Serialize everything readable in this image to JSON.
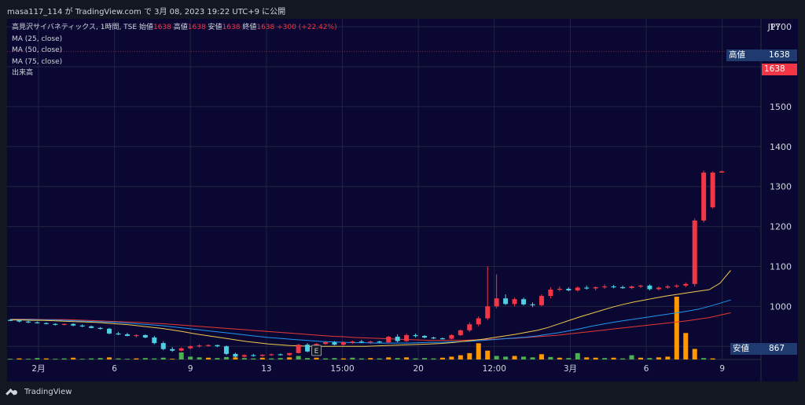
{
  "header": {
    "published_line": "masa117_114 が TradingView.com で 3月 08, 2023 19:22 UTC+9 に公開"
  },
  "legend": {
    "symbol_line": "高見沢サイバネティックス, 1時間, TSE",
    "open_label": "始値",
    "open_value": "1638",
    "high_label": "高値",
    "high_value": "1638",
    "low_label": "安値",
    "low_value": "1638",
    "close_label": "終値",
    "close_value": "1638",
    "change": "+300 (+22.42%)",
    "ma25": "MA (25, close)",
    "ma50": "MA (50, close)",
    "ma75": "MA (75, close)",
    "volume": "出来高"
  },
  "price_axis": {
    "currency": "JPY",
    "ticks": [
      "1700",
      "1600",
      "1500",
      "1400",
      "1300",
      "1200",
      "1100",
      "1000",
      "900"
    ],
    "high_tag_label": "高値",
    "high_tag_value": "1638",
    "last_price_tag": "1638",
    "low_tag_label": "安値",
    "low_tag_value": "867"
  },
  "time_axis": {
    "labels": [
      "2月",
      "6",
      "9",
      "13",
      "15:00",
      "20",
      "12:00",
      "3月",
      "6",
      "9"
    ]
  },
  "earnings_marker": "E",
  "footer": {
    "brand": "TradingView"
  },
  "colors": {
    "up": "#f23645",
    "down": "#22ab94",
    "down_light": "#4dd0e1",
    "ma25": "#f2c94c",
    "ma50": "#2196f3",
    "ma75": "#e53935",
    "vol_up": "#ff9800",
    "vol_down": "#4caf50",
    "tag_blue": "#1e3a6e",
    "last_red": "#f23645",
    "panel_bg": "#0a0833"
  },
  "chart_data": {
    "type": "candlestick",
    "ylim": [
      867,
      1720
    ],
    "y_ticks": [
      900,
      1000,
      1100,
      1200,
      1300,
      1400,
      1500,
      1600,
      1700
    ],
    "x": [
      "2月",
      "6",
      "9",
      "13",
      "15:00",
      "20",
      "12:00",
      "3月",
      "6",
      "9"
    ],
    "candles": [
      {
        "o": 966,
        "h": 968,
        "l": 963,
        "c": 965
      },
      {
        "o": 965,
        "h": 966,
        "l": 960,
        "c": 962
      },
      {
        "o": 962,
        "h": 964,
        "l": 958,
        "c": 960
      },
      {
        "o": 960,
        "h": 962,
        "l": 957,
        "c": 958
      },
      {
        "o": 958,
        "h": 960,
        "l": 955,
        "c": 956
      },
      {
        "o": 956,
        "h": 958,
        "l": 952,
        "c": 955
      },
      {
        "o": 955,
        "h": 957,
        "l": 952,
        "c": 956
      },
      {
        "o": 956,
        "h": 958,
        "l": 950,
        "c": 952
      },
      {
        "o": 952,
        "h": 955,
        "l": 948,
        "c": 950
      },
      {
        "o": 950,
        "h": 952,
        "l": 945,
        "c": 946
      },
      {
        "o": 946,
        "h": 948,
        "l": 942,
        "c": 944
      },
      {
        "o": 944,
        "h": 946,
        "l": 930,
        "c": 932
      },
      {
        "o": 932,
        "h": 936,
        "l": 928,
        "c": 930
      },
      {
        "o": 930,
        "h": 934,
        "l": 925,
        "c": 926
      },
      {
        "o": 926,
        "h": 930,
        "l": 922,
        "c": 928
      },
      {
        "o": 928,
        "h": 930,
        "l": 920,
        "c": 922
      },
      {
        "o": 922,
        "h": 926,
        "l": 905,
        "c": 908
      },
      {
        "o": 908,
        "h": 912,
        "l": 890,
        "c": 893
      },
      {
        "o": 893,
        "h": 898,
        "l": 886,
        "c": 889
      },
      {
        "o": 889,
        "h": 897,
        "l": 887,
        "c": 895
      },
      {
        "o": 895,
        "h": 902,
        "l": 893,
        "c": 900
      },
      {
        "o": 900,
        "h": 905,
        "l": 897,
        "c": 902
      },
      {
        "o": 902,
        "h": 905,
        "l": 899,
        "c": 903
      },
      {
        "o": 903,
        "h": 904,
        "l": 898,
        "c": 900
      },
      {
        "o": 900,
        "h": 902,
        "l": 878,
        "c": 881
      },
      {
        "o": 881,
        "h": 884,
        "l": 872,
        "c": 874
      },
      {
        "o": 874,
        "h": 880,
        "l": 872,
        "c": 878
      },
      {
        "o": 878,
        "h": 881,
        "l": 874,
        "c": 876
      },
      {
        "o": 876,
        "h": 880,
        "l": 874,
        "c": 879
      },
      {
        "o": 879,
        "h": 882,
        "l": 876,
        "c": 880
      },
      {
        "o": 880,
        "h": 882,
        "l": 877,
        "c": 878
      },
      {
        "o": 878,
        "h": 884,
        "l": 876,
        "c": 883
      },
      {
        "o": 883,
        "h": 906,
        "l": 882,
        "c": 904
      },
      {
        "o": 904,
        "h": 908,
        "l": 885,
        "c": 887
      },
      {
        "o": 887,
        "h": 908,
        "l": 886,
        "c": 906
      },
      {
        "o": 906,
        "h": 913,
        "l": 904,
        "c": 910
      },
      {
        "o": 910,
        "h": 913,
        "l": 902,
        "c": 904
      },
      {
        "o": 904,
        "h": 912,
        "l": 902,
        "c": 910
      },
      {
        "o": 910,
        "h": 914,
        "l": 906,
        "c": 912
      },
      {
        "o": 912,
        "h": 916,
        "l": 908,
        "c": 910
      },
      {
        "o": 910,
        "h": 914,
        "l": 906,
        "c": 912
      },
      {
        "o": 912,
        "h": 914,
        "l": 908,
        "c": 910
      },
      {
        "o": 910,
        "h": 926,
        "l": 908,
        "c": 924
      },
      {
        "o": 924,
        "h": 930,
        "l": 910,
        "c": 913
      },
      {
        "o": 913,
        "h": 932,
        "l": 911,
        "c": 928
      },
      {
        "o": 928,
        "h": 932,
        "l": 922,
        "c": 926
      },
      {
        "o": 926,
        "h": 928,
        "l": 920,
        "c": 922
      },
      {
        "o": 922,
        "h": 924,
        "l": 918,
        "c": 920
      },
      {
        "o": 920,
        "h": 922,
        "l": 917,
        "c": 919
      },
      {
        "o": 919,
        "h": 930,
        "l": 917,
        "c": 928
      },
      {
        "o": 928,
        "h": 942,
        "l": 926,
        "c": 940
      },
      {
        "o": 940,
        "h": 960,
        "l": 936,
        "c": 955
      },
      {
        "o": 955,
        "h": 975,
        "l": 950,
        "c": 970
      },
      {
        "o": 970,
        "h": 1100,
        "l": 966,
        "c": 1000
      },
      {
        "o": 1000,
        "h": 1080,
        "l": 995,
        "c": 1020
      },
      {
        "o": 1020,
        "h": 1030,
        "l": 1003,
        "c": 1006
      },
      {
        "o": 1006,
        "h": 1022,
        "l": 1000,
        "c": 1018
      },
      {
        "o": 1018,
        "h": 1022,
        "l": 1002,
        "c": 1005
      },
      {
        "o": 1005,
        "h": 1010,
        "l": 998,
        "c": 1003
      },
      {
        "o": 1003,
        "h": 1030,
        "l": 1000,
        "c": 1026
      },
      {
        "o": 1026,
        "h": 1048,
        "l": 1020,
        "c": 1042
      },
      {
        "o": 1042,
        "h": 1050,
        "l": 1038,
        "c": 1044
      },
      {
        "o": 1044,
        "h": 1048,
        "l": 1038,
        "c": 1040
      },
      {
        "o": 1040,
        "h": 1050,
        "l": 1037,
        "c": 1047
      },
      {
        "o": 1047,
        "h": 1052,
        "l": 1042,
        "c": 1045
      },
      {
        "o": 1045,
        "h": 1050,
        "l": 1040,
        "c": 1048
      },
      {
        "o": 1048,
        "h": 1055,
        "l": 1044,
        "c": 1050
      },
      {
        "o": 1050,
        "h": 1054,
        "l": 1045,
        "c": 1048
      },
      {
        "o": 1048,
        "h": 1052,
        "l": 1044,
        "c": 1046
      },
      {
        "o": 1046,
        "h": 1052,
        "l": 1043,
        "c": 1050
      },
      {
        "o": 1050,
        "h": 1054,
        "l": 1046,
        "c": 1052
      },
      {
        "o": 1052,
        "h": 1055,
        "l": 1040,
        "c": 1043
      },
      {
        "o": 1043,
        "h": 1050,
        "l": 1040,
        "c": 1047
      },
      {
        "o": 1047,
        "h": 1054,
        "l": 1044,
        "c": 1050
      },
      {
        "o": 1050,
        "h": 1055,
        "l": 1046,
        "c": 1052
      },
      {
        "o": 1052,
        "h": 1060,
        "l": 1048,
        "c": 1056
      },
      {
        "o": 1056,
        "h": 1220,
        "l": 1050,
        "c": 1215
      },
      {
        "o": 1215,
        "h": 1340,
        "l": 1210,
        "c": 1335
      },
      {
        "o": 1248,
        "h": 1338,
        "l": 1245,
        "c": 1335
      },
      {
        "o": 1335,
        "h": 1340,
        "l": 1335,
        "c": 1338
      },
      {
        "o": 1638,
        "h": 1638,
        "l": 1638,
        "c": 1638
      }
    ],
    "volume": [
      {
        "v": 2,
        "up": false
      },
      {
        "v": 3,
        "up": true
      },
      {
        "v": 2,
        "up": false
      },
      {
        "v": 4,
        "up": false
      },
      {
        "v": 3,
        "up": true
      },
      {
        "v": 2,
        "up": false
      },
      {
        "v": 3,
        "up": false
      },
      {
        "v": 5,
        "up": true
      },
      {
        "v": 2,
        "up": false
      },
      {
        "v": 3,
        "up": false
      },
      {
        "v": 4,
        "up": false
      },
      {
        "v": 6,
        "up": true
      },
      {
        "v": 3,
        "up": false
      },
      {
        "v": 2,
        "up": false
      },
      {
        "v": 3,
        "up": true
      },
      {
        "v": 4,
        "up": false
      },
      {
        "v": 3,
        "up": false
      },
      {
        "v": 5,
        "up": false
      },
      {
        "v": 2,
        "up": true
      },
      {
        "v": 20,
        "up": false
      },
      {
        "v": 8,
        "up": false
      },
      {
        "v": 6,
        "up": false
      },
      {
        "v": 5,
        "up": true
      },
      {
        "v": 4,
        "up": false
      },
      {
        "v": 7,
        "up": false
      },
      {
        "v": 6,
        "up": true
      },
      {
        "v": 4,
        "up": false
      },
      {
        "v": 3,
        "up": false
      },
      {
        "v": 5,
        "up": true
      },
      {
        "v": 3,
        "up": false
      },
      {
        "v": 4,
        "up": false
      },
      {
        "v": 6,
        "up": true
      },
      {
        "v": 10,
        "up": false
      },
      {
        "v": 4,
        "up": false
      },
      {
        "v": 5,
        "up": true
      },
      {
        "v": 3,
        "up": false
      },
      {
        "v": 4,
        "up": false
      },
      {
        "v": 3,
        "up": true
      },
      {
        "v": 5,
        "up": false
      },
      {
        "v": 3,
        "up": false
      },
      {
        "v": 4,
        "up": true
      },
      {
        "v": 3,
        "up": false
      },
      {
        "v": 6,
        "up": true
      },
      {
        "v": 4,
        "up": false
      },
      {
        "v": 6,
        "up": true
      },
      {
        "v": 3,
        "up": false
      },
      {
        "v": 4,
        "up": false
      },
      {
        "v": 3,
        "up": false
      },
      {
        "v": 5,
        "up": true
      },
      {
        "v": 8,
        "up": true
      },
      {
        "v": 12,
        "up": true
      },
      {
        "v": 18,
        "up": true
      },
      {
        "v": 46,
        "up": true
      },
      {
        "v": 25,
        "up": true
      },
      {
        "v": 10,
        "up": false
      },
      {
        "v": 8,
        "up": false
      },
      {
        "v": 10,
        "up": true
      },
      {
        "v": 8,
        "up": false
      },
      {
        "v": 6,
        "up": false
      },
      {
        "v": 15,
        "up": true
      },
      {
        "v": 7,
        "up": false
      },
      {
        "v": 5,
        "up": true
      },
      {
        "v": 4,
        "up": false
      },
      {
        "v": 18,
        "up": false
      },
      {
        "v": 6,
        "up": true
      },
      {
        "v": 5,
        "up": true
      },
      {
        "v": 4,
        "up": false
      },
      {
        "v": 5,
        "up": true
      },
      {
        "v": 3,
        "up": false
      },
      {
        "v": 12,
        "up": false
      },
      {
        "v": 5,
        "up": true
      },
      {
        "v": 4,
        "up": false
      },
      {
        "v": 6,
        "up": true
      },
      {
        "v": 8,
        "up": true
      },
      {
        "v": 178,
        "up": true
      },
      {
        "v": 75,
        "up": true
      },
      {
        "v": 30,
        "up": true
      },
      {
        "v": 4,
        "up": false
      },
      {
        "v": 3,
        "up": true
      }
    ],
    "ma25": [
      966,
      966,
      965,
      965,
      964,
      963,
      962,
      961,
      960,
      958,
      956,
      954,
      951,
      948,
      945,
      941,
      937,
      932,
      928,
      924,
      920,
      916,
      912,
      909,
      906,
      904,
      902,
      901,
      900,
      900,
      900,
      900,
      900,
      900,
      901,
      902,
      903,
      904,
      905,
      906,
      907,
      909,
      912,
      915,
      918,
      922,
      926,
      930,
      935,
      940,
      947,
      956,
      965,
      974,
      982,
      990,
      998,
      1005,
      1011,
      1016,
      1021,
      1026,
      1030,
      1034,
      1038,
      1042,
      1058,
      1090
    ],
    "ma50": [
      967,
      967,
      967,
      966,
      966,
      965,
      964,
      963,
      962,
      961,
      960,
      958,
      956,
      954,
      952,
      949,
      946,
      943,
      940,
      937,
      934,
      931,
      928,
      925,
      922,
      920,
      918,
      916,
      914,
      912,
      911,
      910,
      909,
      909,
      908,
      908,
      908,
      908,
      909,
      910,
      910,
      911,
      912,
      913,
      915,
      917,
      919,
      921,
      923,
      926,
      930,
      934,
      939,
      944,
      950,
      955,
      960,
      964,
      968,
      972,
      976,
      980,
      984,
      988,
      993,
      1000,
      1008,
      1016
    ],
    "ma75": [
      968,
      968,
      968,
      967,
      967,
      967,
      966,
      965,
      964,
      963,
      962,
      961,
      960,
      958,
      957,
      955,
      953,
      951,
      949,
      947,
      945,
      943,
      941,
      939,
      937,
      935,
      933,
      931,
      929,
      927,
      925,
      924,
      922,
      921,
      920,
      919,
      918,
      917,
      916,
      915,
      915,
      915,
      915,
      916,
      917,
      918,
      919,
      920,
      922,
      924,
      926,
      928,
      931,
      934,
      937,
      940,
      943,
      946,
      949,
      952,
      955,
      958,
      961,
      964,
      968,
      972,
      978,
      984
    ]
  }
}
